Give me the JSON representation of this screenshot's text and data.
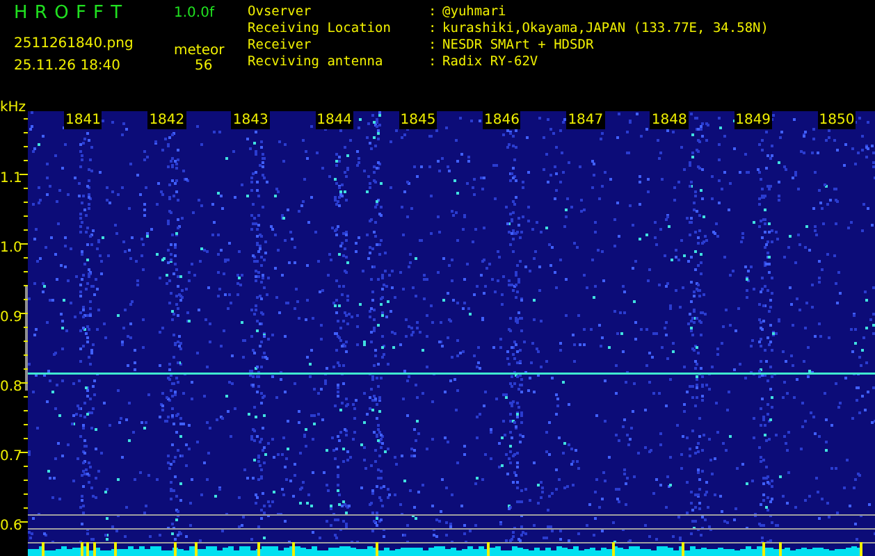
{
  "app": {
    "title": "H R O F F T",
    "version": "1.0.0f",
    "filename": "2511261840.png",
    "datetime": "25.11.26 18:40",
    "detection_label": "meteor",
    "detection_count": "56"
  },
  "station_info": [
    {
      "label": "Ovserver",
      "separator": ":",
      "value": "@yuhmari"
    },
    {
      "label": "Receiving Location",
      "separator": ":",
      "value": "kurashiki,Okayama,JAPAN (133.77E, 34.58N)"
    },
    {
      "label": "Receiver",
      "separator": ":",
      "value": "NESDR SMArt + HDSDR"
    },
    {
      "label": "Recviving antenna",
      "separator": ":",
      "value": "Radix RY-62V"
    }
  ],
  "waterfall": {
    "unit": "kHz",
    "frequency_labels": [
      "1.1",
      "1.0",
      "0.9",
      "0.8",
      "0.7",
      "0.6"
    ],
    "time_labels": [
      "1841",
      "1842",
      "1843",
      "1844",
      "1845",
      "1846",
      "1847",
      "1848",
      "1849",
      "1850"
    ]
  }
}
